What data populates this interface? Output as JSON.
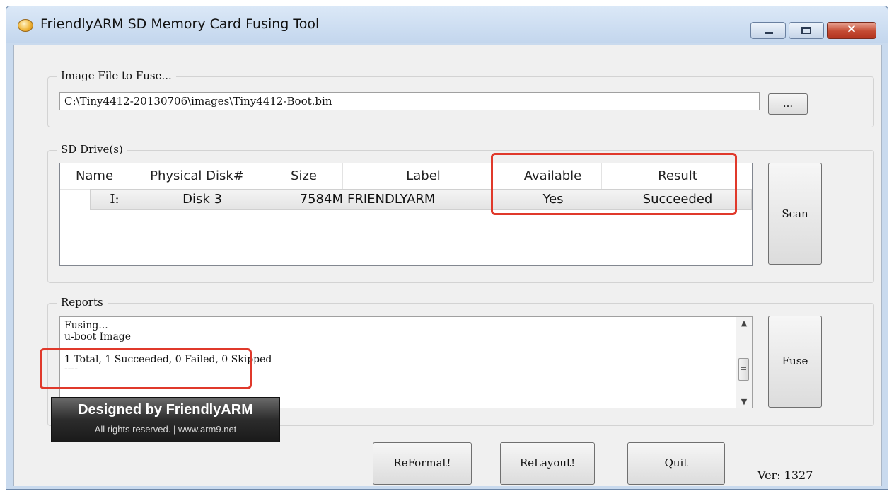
{
  "window": {
    "title": "FriendlyARM SD Memory Card Fusing Tool",
    "close_symbol": "×",
    "icons": [
      "app-icon",
      "minimize-icon",
      "maximize-icon",
      "close-icon"
    ]
  },
  "image_file": {
    "group_label": "Image File to Fuse...",
    "path_value": "C:\\Tiny4412-20130706\\images\\Tiny4412-Boot.bin",
    "browse_label": "..."
  },
  "sd_drives": {
    "group_label": "SD Drive(s)",
    "columns": [
      "Name",
      "Physical Disk#",
      "Size",
      "Label",
      "Available",
      "Result"
    ],
    "rows": [
      {
        "name": "I:",
        "physical_disk": "Disk 3",
        "size": "7584M",
        "label": "FRIENDLYARM",
        "available": "Yes",
        "result": "Succeeded"
      }
    ],
    "scan_label": "Scan"
  },
  "reports": {
    "group_label": "Reports",
    "lines": [
      "Fusing...",
      "u-boot Image",
      "",
      "1 Total, 1 Succeeded, 0 Failed, 0 Skipped",
      "----"
    ],
    "fuse_label": "Fuse"
  },
  "footer": {
    "logo_title": "Designed by FriendlyARM",
    "logo_subtitle": "All rights reserved. | www.arm9.net",
    "reformat_label": "ReFormat!",
    "relayout_label": "ReLayout!",
    "quit_label": "Quit",
    "version": "Ver: 1327"
  },
  "colors": {
    "highlight": "#e0392b",
    "title_bar": "#c9daee"
  }
}
